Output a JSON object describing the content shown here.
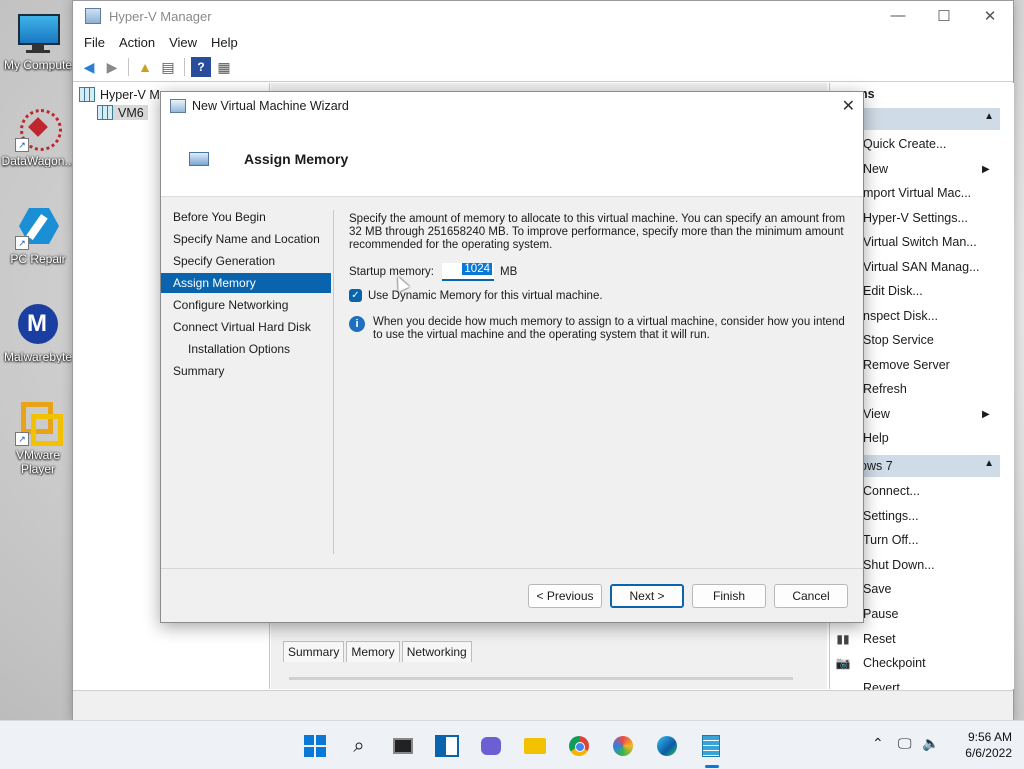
{
  "desktop": {
    "icons": [
      {
        "label": "My Compute",
        "icon": "monitor-icon"
      },
      {
        "label": "DataWagon...",
        "icon": "datawagon-icon"
      },
      {
        "label": "PC Repair",
        "icon": "pc-repair-icon"
      },
      {
        "label": "Malwarebyte",
        "icon": "malwarebytes-icon"
      },
      {
        "label": "VMware\nPlayer",
        "icon": "vmware-icon"
      }
    ]
  },
  "hyperv": {
    "title": "Hyper-V Manager",
    "menu": [
      "File",
      "Action",
      "View",
      "Help"
    ],
    "tree": {
      "root": "Hyper-V Ma",
      "child": "VM6"
    },
    "actions": {
      "header1": "ns",
      "group1": [
        {
          "label": "Quick Create...",
          "has_arrow": false
        },
        {
          "label": "New",
          "has_arrow": true
        },
        {
          "label": "mport Virtual Mac...",
          "has_arrow": false
        },
        {
          "label": "Hyper-V Settings...",
          "has_arrow": false
        },
        {
          "label": "Virtual Switch Man...",
          "has_arrow": false
        },
        {
          "label": "Virtual SAN Manag...",
          "has_arrow": false
        },
        {
          "label": "Edit Disk...",
          "has_arrow": false
        },
        {
          "label": "nspect Disk...",
          "has_arrow": false
        },
        {
          "label": "Stop Service",
          "has_arrow": false
        },
        {
          "label": "Remove Server",
          "has_arrow": false
        },
        {
          "label": "Refresh",
          "has_arrow": false
        },
        {
          "label": "View",
          "has_arrow": true
        },
        {
          "label": "Help",
          "has_arrow": false
        }
      ],
      "header2": "ows 7",
      "group2": [
        {
          "label": "Connect..."
        },
        {
          "label": "Settings..."
        },
        {
          "label": "Turn Off..."
        },
        {
          "label": "Shut Down..."
        },
        {
          "label": "Save"
        },
        {
          "label": "Pause"
        },
        {
          "label": "Reset"
        },
        {
          "label": "Checkpoint"
        },
        {
          "label": "Revert"
        }
      ]
    },
    "detail_tabs": [
      "Summary",
      "Memory",
      "Networking"
    ]
  },
  "wizard": {
    "title": "New Virtual Machine Wizard",
    "page_title": "Assign Memory",
    "steps": [
      {
        "label": "Before You Begin",
        "sub": false,
        "active": false
      },
      {
        "label": "Specify Name and Location",
        "sub": false,
        "active": false
      },
      {
        "label": "Specify Generation",
        "sub": false,
        "active": false
      },
      {
        "label": "Assign Memory",
        "sub": false,
        "active": true
      },
      {
        "label": "Configure Networking",
        "sub": false,
        "active": false
      },
      {
        "label": "Connect Virtual Hard Disk",
        "sub": false,
        "active": false
      },
      {
        "label": "Installation Options",
        "sub": true,
        "active": false
      },
      {
        "label": "Summary",
        "sub": false,
        "active": false
      }
    ],
    "description": "Specify the amount of memory to allocate to this virtual machine. You can specify an amount from 32 MB through 251658240 MB. To improve performance, specify more than the minimum amount recommended for the operating system.",
    "startup_memory_label": "Startup memory:",
    "startup_memory_value": "1024",
    "startup_memory_unit": "MB",
    "dynamic_memory_label": "Use Dynamic Memory for this virtual machine.",
    "dynamic_memory_checked": true,
    "info_text": "When you decide how much memory to assign to a virtual machine, consider how you intend to use the virtual machine and the operating system that it will run.",
    "buttons": {
      "previous": "< Previous",
      "next": "Next >",
      "finish": "Finish",
      "cancel": "Cancel"
    }
  },
  "taskbar": {
    "time": "9:56 AM",
    "date": "6/6/2022",
    "apps": [
      "windows-start-icon",
      "search-icon",
      "task-view-icon",
      "widgets-icon",
      "chat-icon",
      "file-explorer-icon",
      "chrome-icon",
      "app-icon",
      "edge-icon",
      "hyperv-icon"
    ]
  },
  "colors": {
    "accent": "#0a64ad",
    "actions_header": "#cfdbe7"
  }
}
